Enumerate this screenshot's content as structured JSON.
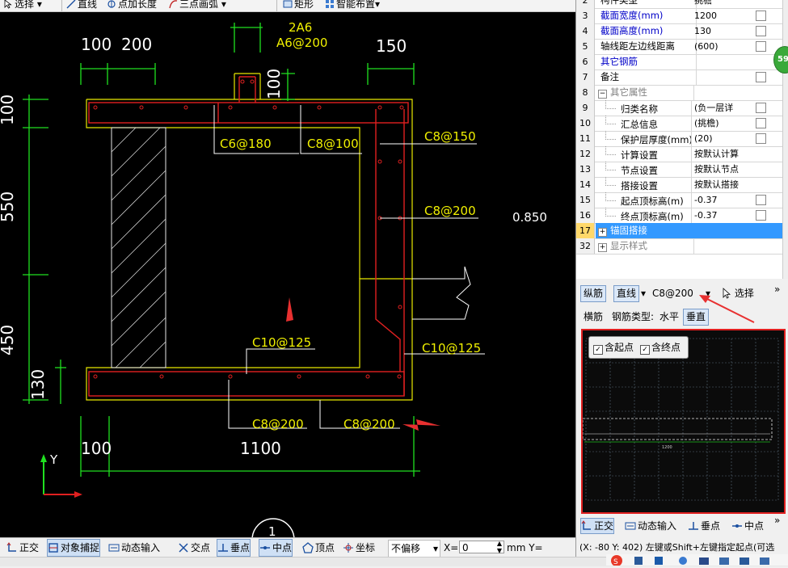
{
  "toolbar": {
    "select": "选择",
    "line": "直线",
    "point_length": "点加长度",
    "arc": "三点画弧",
    "rect": "矩形",
    "smart_layout": "智能布置"
  },
  "canvas": {
    "dims": {
      "d100_top": "100",
      "d200_top": "200",
      "d150_top": "150",
      "left_100": "100",
      "left_550": "550",
      "left_450": "450",
      "left_130": "130",
      "top_100_vertical": "100",
      "bottom_100": "100",
      "bottom_1100": "1100"
    },
    "rebar_labels": {
      "two_a6": "2A6",
      "a6_200": "A6@200",
      "c6_180": "C6@180",
      "c8_100": "C8@100",
      "c8_150": "C8@150",
      "c8_200_right": "C8@200",
      "c10_125_mid": "C10@125",
      "c10_125_right": "C10@125",
      "c8_200_bottom_left": "C8@200",
      "c8_200_bottom_right": "C8@200"
    },
    "value_0850": "0.850",
    "axis_y": "Y",
    "circle_number": "1"
  },
  "properties": {
    "rows": [
      {
        "num": "2",
        "name": "构件类型",
        "value": "挑檐",
        "checkbox": false,
        "color": "black",
        "indent": false
      },
      {
        "num": "3",
        "name": "截面宽度(mm)",
        "value": "1200",
        "checkbox": true,
        "color": "blue",
        "indent": false
      },
      {
        "num": "4",
        "name": "截面高度(mm)",
        "value": "130",
        "checkbox": true,
        "color": "blue",
        "indent": false
      },
      {
        "num": "5",
        "name": "轴线距左边线距离",
        "value": "(600)",
        "checkbox": true,
        "color": "black",
        "indent": false
      },
      {
        "num": "6",
        "name": "其它钢筋",
        "value": "",
        "checkbox": false,
        "color": "blue",
        "indent": false
      },
      {
        "num": "7",
        "name": "备注",
        "value": "",
        "checkbox": true,
        "color": "black",
        "indent": false
      },
      {
        "num": "8",
        "name": "其它属性",
        "value": "",
        "checkbox": false,
        "color": "gray",
        "indent": false,
        "expander": "−"
      },
      {
        "num": "9",
        "name": "归类名称",
        "value": "(负一层详",
        "checkbox": true,
        "color": "black",
        "indent": true
      },
      {
        "num": "10",
        "name": "汇总信息",
        "value": "(挑檐)",
        "checkbox": true,
        "color": "black",
        "indent": true
      },
      {
        "num": "11",
        "name": "保护层厚度(mm)",
        "value": "(20)",
        "checkbox": true,
        "color": "black",
        "indent": true
      },
      {
        "num": "12",
        "name": "计算设置",
        "value": "按默认计算",
        "checkbox": false,
        "color": "black",
        "indent": true
      },
      {
        "num": "13",
        "name": "节点设置",
        "value": "按默认节点",
        "checkbox": false,
        "color": "black",
        "indent": true
      },
      {
        "num": "14",
        "name": "搭接设置",
        "value": "按默认搭接",
        "checkbox": false,
        "color": "black",
        "indent": true
      },
      {
        "num": "15",
        "name": "起点顶标高(m)",
        "value": "-0.37",
        "checkbox": true,
        "color": "black",
        "indent": true
      },
      {
        "num": "16",
        "name": "终点顶标高(m)",
        "value": "-0.37",
        "checkbox": true,
        "color": "black",
        "indent": true
      },
      {
        "num": "17",
        "name": "锚固搭接",
        "value": "",
        "checkbox": false,
        "color": "white",
        "indent": false,
        "expander": "+",
        "selected": true
      },
      {
        "num": "32",
        "name": "显示样式",
        "value": "",
        "checkbox": false,
        "color": "gray",
        "indent": false,
        "expander": "+"
      }
    ],
    "badge": "59"
  },
  "rebar_panel": {
    "longitudinal": "纵筋",
    "line": "直线",
    "rebar_spec": "C8@200",
    "select": "选择",
    "transverse": "横筋",
    "rebar_type_label": "钢筋类型:",
    "horizontal": "水平",
    "vertical": "垂直",
    "include_start": "含起点",
    "include_end": "含终点",
    "preview_dim": "1200",
    "ortho": "正交",
    "dynamic_input": "动态输入",
    "perpendicular": "垂点",
    "midpoint": "中点",
    "status_text": "(X: -80 Y: 402)    左键或Shift+左键指定起点(可选"
  },
  "statusbar": {
    "ortho": "正交",
    "object_snap": "对象捕捉",
    "dynamic_input": "动态输入",
    "intersection": "交点",
    "perpendicular": "垂点",
    "midpoint": "中点",
    "vertex": "顶点",
    "coordinate": "坐标",
    "no_offset": "不偏移",
    "x_label": "X=",
    "x_value": "0",
    "unit_y": "mm Y="
  }
}
